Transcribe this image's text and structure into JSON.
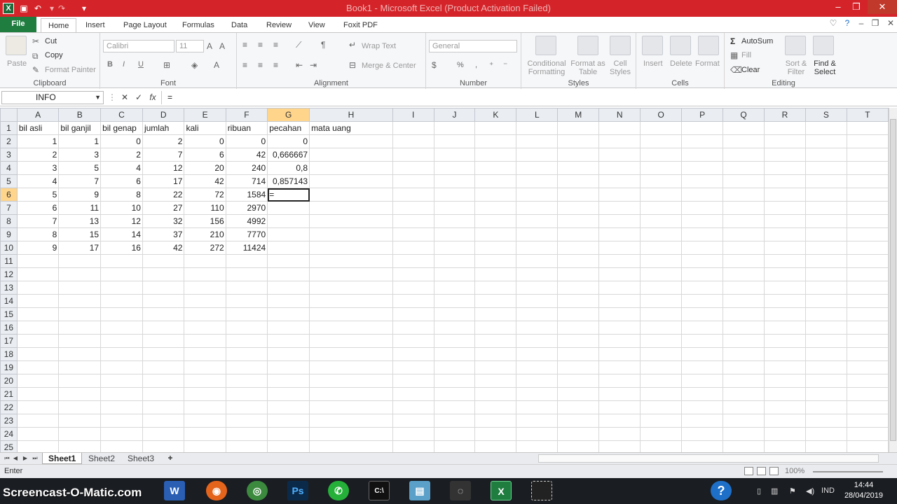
{
  "window": {
    "title": "Book1 - Microsoft Excel (Product Activation Failed)"
  },
  "tabs": [
    "File",
    "Home",
    "Insert",
    "Page Layout",
    "Formulas",
    "Data",
    "Review",
    "View",
    "Foxit PDF"
  ],
  "ribbon": {
    "clipboard": {
      "paste": "Paste",
      "cut": "Cut",
      "copy": "Copy",
      "format_painter": "Format Painter",
      "label": "Clipboard"
    },
    "font": {
      "name": "Calibri",
      "size": "11",
      "label": "Font",
      "bold": "B",
      "italic": "I",
      "underline": "U"
    },
    "alignment": {
      "wrap": "Wrap Text",
      "merge": "Merge & Center",
      "label": "Alignment"
    },
    "number": {
      "format": "General",
      "percent": "%",
      "comma": ",",
      "label": "Number"
    },
    "styles": {
      "conditional": "Conditional Formatting",
      "table": "Format as Table",
      "cell": "Cell Styles",
      "label": "Styles"
    },
    "cells": {
      "insert": "Insert",
      "delete": "Delete",
      "format": "Format",
      "label": "Cells"
    },
    "editing": {
      "autosum": "AutoSum",
      "fill": "Fill",
      "clear": "Clear",
      "sort": "Sort & Filter",
      "find": "Find & Select",
      "label": "Editing"
    }
  },
  "formula_bar": {
    "name_box": "INFO",
    "content": "="
  },
  "grid": {
    "columns": [
      "A",
      "B",
      "C",
      "D",
      "E",
      "F",
      "G",
      "H",
      "I",
      "J",
      "K",
      "L",
      "M",
      "N",
      "O",
      "P",
      "Q",
      "R",
      "S",
      "T"
    ],
    "selected_column": "G",
    "selected_row": "6",
    "rows": [
      [
        "bil asli",
        "bil ganjil",
        "bil genap",
        "jumlah",
        "kali",
        "ribuan",
        "pecahan",
        "mata uang"
      ],
      [
        "1",
        "1",
        "0",
        "2",
        "0",
        "0",
        "0",
        ""
      ],
      [
        "2",
        "3",
        "2",
        "7",
        "6",
        "42",
        "0,666667",
        ""
      ],
      [
        "3",
        "5",
        "4",
        "12",
        "20",
        "240",
        "0,8",
        ""
      ],
      [
        "4",
        "7",
        "6",
        "17",
        "42",
        "714",
        "0,857143",
        ""
      ],
      [
        "5",
        "9",
        "8",
        "22",
        "72",
        "1584",
        "=",
        ""
      ],
      [
        "6",
        "11",
        "10",
        "27",
        "110",
        "2970",
        "",
        ""
      ],
      [
        "7",
        "13",
        "12",
        "32",
        "156",
        "4992",
        "",
        ""
      ],
      [
        "8",
        "15",
        "14",
        "37",
        "210",
        "7770",
        "",
        ""
      ],
      [
        "9",
        "17",
        "16",
        "42",
        "272",
        "11424",
        "",
        ""
      ]
    ],
    "row_numbers": [
      "1",
      "2",
      "3",
      "4",
      "5",
      "6",
      "7",
      "8",
      "9",
      "10",
      "11",
      "12",
      "13",
      "14",
      "15",
      "16",
      "17",
      "18",
      "19",
      "20",
      "21",
      "22",
      "23",
      "24",
      "25"
    ]
  },
  "sheets": [
    "Sheet1",
    "Sheet2",
    "Sheet3"
  ],
  "status": {
    "mode": "Enter",
    "zoom": "100%"
  },
  "taskbar": {
    "brand": "Screencast-O-Matic.com",
    "lang": "IND",
    "time": "14:44",
    "date": "28/04/2019"
  }
}
